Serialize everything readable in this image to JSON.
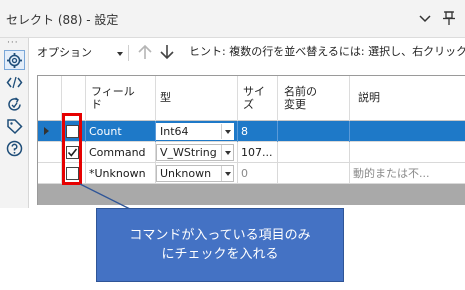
{
  "window": {
    "title": "セレクト (88) - 設定"
  },
  "toolbar": {
    "options_label": "オプション",
    "hint": "ヒント: 複数の行を並べ替えるには: 選択し、右クリックして"
  },
  "left_rail": {
    "icons": [
      "gear-icon",
      "code-icon",
      "refresh-icon",
      "tag-icon",
      "help-icon"
    ]
  },
  "table": {
    "headers": {
      "field_line1": "フィール",
      "field_line2": "ド",
      "type": "型",
      "size_line1": "サイ",
      "size_line2": "ズ",
      "rename_line1": "名前の",
      "rename_line2": "変更",
      "description": "説明"
    },
    "rows": [
      {
        "field": "Count",
        "type": "Int64",
        "size": "8",
        "rename": "",
        "description": "",
        "checked": false,
        "selected": true
      },
      {
        "field": "Command",
        "type": "V_WString",
        "size": "107...",
        "rename": "",
        "description": "",
        "checked": true,
        "selected": false
      },
      {
        "field": "*Unknown",
        "type": "Unknown",
        "size": "0",
        "rename": "",
        "description": "動的または不...",
        "checked": false,
        "selected": false
      }
    ]
  },
  "callout": {
    "line1": "コマンドが入っている項目のみ",
    "line2": "にチェックを入れる"
  },
  "colors": {
    "selected_row": "#1e79c8",
    "highlight_box": "#e60000",
    "callout_fill": "#4472c4"
  }
}
